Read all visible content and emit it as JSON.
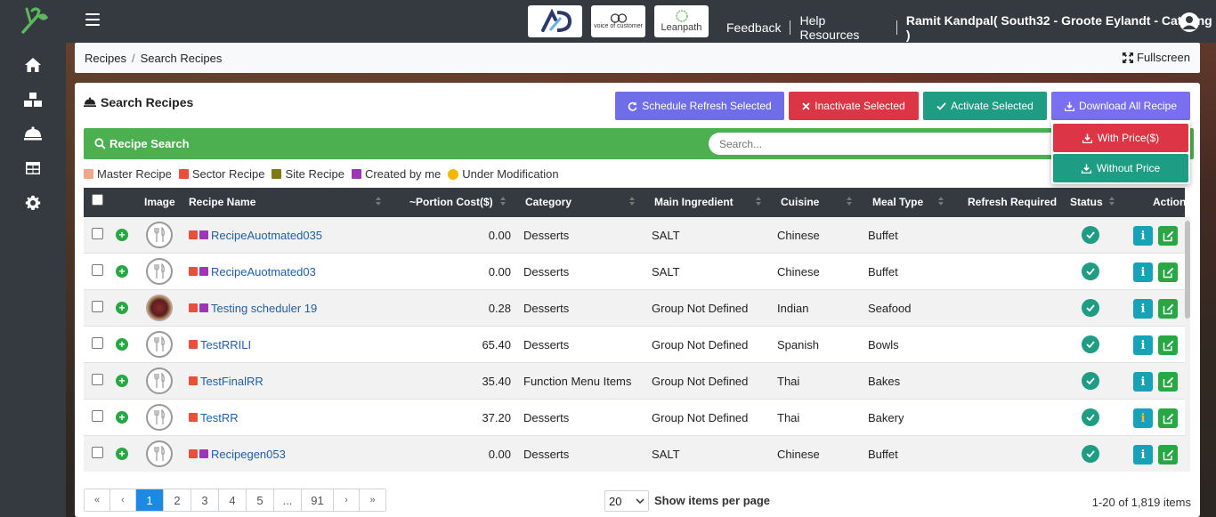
{
  "colors": {
    "sidebar_bg": "#343a40",
    "accent_green": "#4caf50",
    "schedule_btn": "#6f6ee8",
    "inactivate_btn": "#dc3545",
    "activate_btn": "#1e9c84",
    "download_btn": "#7a6ff0",
    "with_price_btn": "#dc3545",
    "without_price_btn": "#1e9c84",
    "master": "#f4a58a",
    "sector": "#e8503a",
    "site": "#807a12",
    "created_by_me": "#9c36b5",
    "under_modification": "#f5b800"
  },
  "sidebar": {
    "logo_icon": "fork-leaf-logo-icon",
    "items": [
      {
        "icon": "home-icon"
      },
      {
        "icon": "boxes-icon"
      },
      {
        "icon": "cloche-icon"
      },
      {
        "icon": "table-icon"
      },
      {
        "icon": "gear-icon"
      }
    ]
  },
  "topbar": {
    "brand_tiles": [
      {
        "text": "AD",
        "icon": "ad-logo-icon"
      },
      {
        "text": "voice of customer",
        "icon": "voc-logo-icon"
      },
      {
        "text": "Leanpath",
        "icon": "leanpath-logo-icon"
      }
    ],
    "links": [
      "Feedback",
      "Help Resources"
    ],
    "user": "Ramit Kandpal( South32 - Groote Eylandt - Catering )"
  },
  "breadcrumb": {
    "items": [
      "Recipes",
      "Search Recipes"
    ],
    "separator": "/",
    "fullscreen": "Fullscreen"
  },
  "card": {
    "title": "Search Recipes",
    "buttons": {
      "schedule": "Schedule Refresh Selected",
      "inactivate": "Inactivate Selected",
      "activate": "Activate Selected",
      "download": "Download All Recipe"
    },
    "download_menu": {
      "with_price": "With Price($)",
      "without_price": "Without Price"
    },
    "search": {
      "label": "Recipe Search",
      "placeholder": "Search..."
    },
    "legend": [
      "Master Recipe",
      "Sector Recipe",
      "Site Recipe",
      "Created by me",
      "Under Modification"
    ]
  },
  "table": {
    "headers": {
      "image": "Image",
      "name": "Recipe Name",
      "portion_cost": "~Portion Cost($)",
      "category": "Category",
      "main_ingredient": "Main Ingredient",
      "cuisine": "Cuisine",
      "meal_type": "Meal Type",
      "refresh_required": "Refresh Required",
      "status": "Status",
      "action": "Action"
    },
    "rows": [
      {
        "name": "RecipeAuotmated035",
        "cost": "0.00",
        "category": "Desserts",
        "ingredient": "SALT",
        "cuisine": "Chinese",
        "meal": "Buffet",
        "tags": [
          "sector",
          "created_by_me"
        ],
        "photo": false,
        "info_warn": false
      },
      {
        "name": "RecipeAuotmated03",
        "cost": "0.00",
        "category": "Desserts",
        "ingredient": "SALT",
        "cuisine": "Chinese",
        "meal": "Buffet",
        "tags": [
          "sector",
          "created_by_me"
        ],
        "photo": false,
        "info_warn": false
      },
      {
        "name": "Testing scheduler 19",
        "cost": "0.28",
        "category": "Desserts",
        "ingredient": "Group Not Defined",
        "cuisine": "Indian",
        "meal": "Seafood",
        "tags": [
          "sector",
          "created_by_me"
        ],
        "photo": true,
        "info_warn": false
      },
      {
        "name": "TestRRILI",
        "cost": "65.40",
        "category": "Desserts",
        "ingredient": "Group Not Defined",
        "cuisine": "Spanish",
        "meal": "Bowls",
        "tags": [
          "sector"
        ],
        "photo": false,
        "info_warn": false
      },
      {
        "name": "TestFinalRR",
        "cost": "35.40",
        "category": "Function Menu Items",
        "ingredient": "Group Not Defined",
        "cuisine": "Thai",
        "meal": "Bakes",
        "tags": [
          "sector"
        ],
        "photo": false,
        "info_warn": false
      },
      {
        "name": "TestRR",
        "cost": "37.20",
        "category": "Desserts",
        "ingredient": "Group Not Defined",
        "cuisine": "Thai",
        "meal": "Bakery",
        "tags": [
          "sector"
        ],
        "photo": false,
        "info_warn": true
      },
      {
        "name": "Recipegen053",
        "cost": "0.00",
        "category": "Desserts",
        "ingredient": "SALT",
        "cuisine": "Chinese",
        "meal": "Buffet",
        "tags": [
          "sector",
          "created_by_me"
        ],
        "photo": false,
        "info_warn": false
      }
    ]
  },
  "pagination": {
    "first": "«",
    "prev": "‹",
    "pages": [
      "1",
      "2",
      "3",
      "4",
      "5",
      "...",
      "91"
    ],
    "current": "1",
    "next": "›",
    "last": "»",
    "per_page": "20",
    "per_page_label": "Show items per page",
    "summary": "1-20 of 1,819 items"
  }
}
